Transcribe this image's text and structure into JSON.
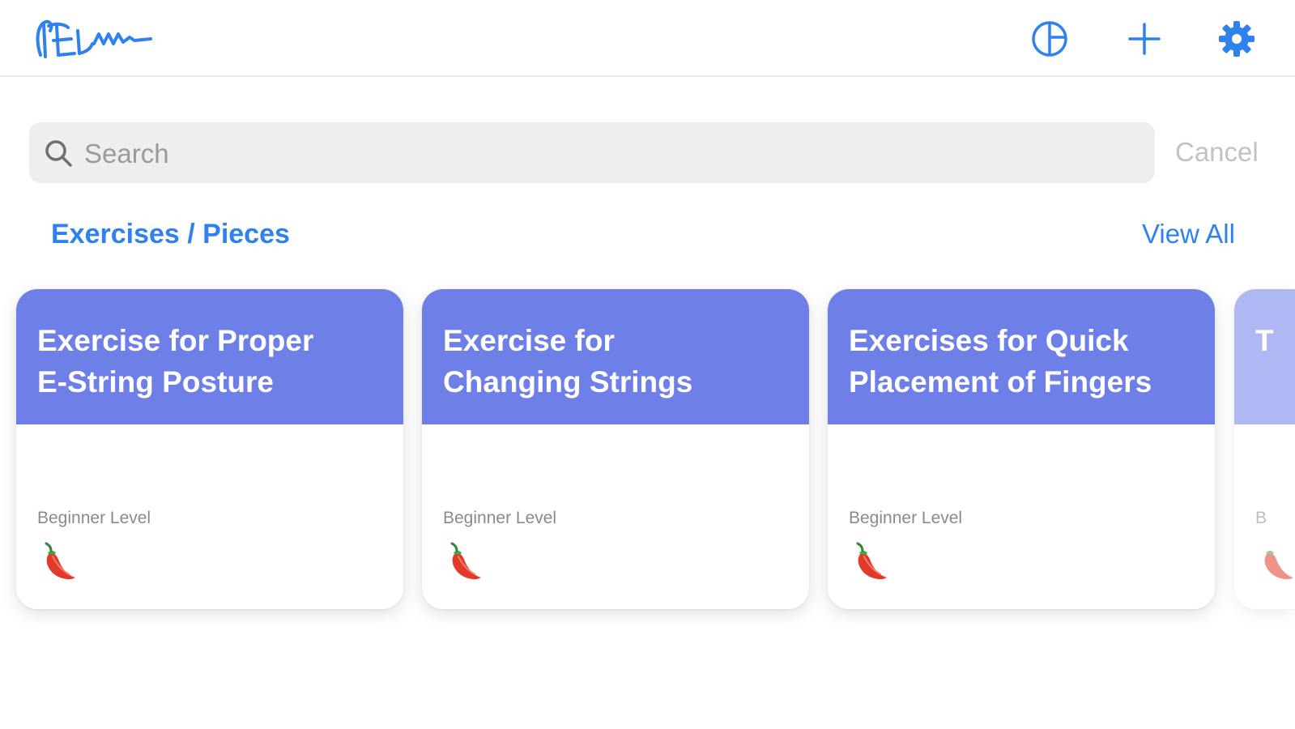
{
  "header": {
    "logo_icon": "handwritten-app-logo",
    "actions": [
      {
        "name": "globe-icon"
      },
      {
        "name": "plus-icon"
      },
      {
        "name": "gear-icon"
      }
    ],
    "accent_color": "#2f82ee"
  },
  "search": {
    "placeholder": "Search",
    "value": "",
    "cancel_label": "Cancel"
  },
  "section": {
    "title": "Exercises / Pieces",
    "view_all_label": "View All"
  },
  "cards": [
    {
      "title": "Exercise for Proper\nE-String Posture",
      "level": "Beginner Level",
      "difficulty_icon": "chili-pepper-icon",
      "difficulty_count": 1
    },
    {
      "title": "Exercise for\nChanging Strings",
      "level": "Beginner Level",
      "difficulty_icon": "chili-pepper-icon",
      "difficulty_count": 1
    },
    {
      "title": "Exercises for Quick\nPlacement of Fingers",
      "level": "Beginner Level",
      "difficulty_icon": "chili-pepper-icon",
      "difficulty_count": 1
    },
    {
      "title": "T",
      "level": "B",
      "difficulty_icon": "chili-pepper-icon",
      "difficulty_count": 1
    }
  ],
  "colors": {
    "card_header": "#6e7fe8",
    "search_bg": "#eeeeee",
    "cancel_text": "#c2c2c2"
  }
}
